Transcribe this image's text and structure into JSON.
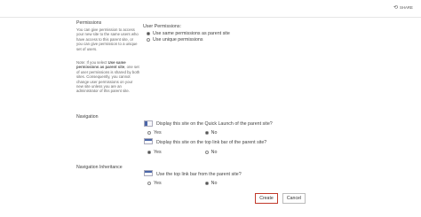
{
  "header": {
    "share_label": "SHARE"
  },
  "permissions": {
    "section_title": "Permissions",
    "description_1": "You can give permission to access your new site to the same users who have access to this parent site, or you can give permission to a unique set of users.",
    "note_prefix": "Note: If you select ",
    "note_bold": "Use same permissions as parent site",
    "note_suffix": ", one set of user permissions is shared by both sites. Consequently, you cannot change user permissions on your new site unless you are an administrator of this parent site.",
    "field_label": "User Permissions:",
    "options": [
      {
        "label": "Use same permissions as parent site",
        "selected": true
      },
      {
        "label": "Use unique permissions",
        "selected": false
      }
    ]
  },
  "navigation": {
    "section_title": "Navigation",
    "question_1": "Display this site on the Quick Launch of the parent site?",
    "q1_yes": "Yes",
    "q1_no": "No",
    "q1_selected": "No",
    "question_2": "Display this site on the top link bar of the parent site?",
    "q2_yes": "Yes",
    "q2_no": "No",
    "q2_selected": "Yes"
  },
  "navigation_inheritance": {
    "section_title": "Navigation Inheritance",
    "question": "Use the top link bar from the parent site?",
    "yes": "Yes",
    "no": "No",
    "selected": "No"
  },
  "buttons": {
    "create": "Create",
    "cancel": "Cancel"
  }
}
